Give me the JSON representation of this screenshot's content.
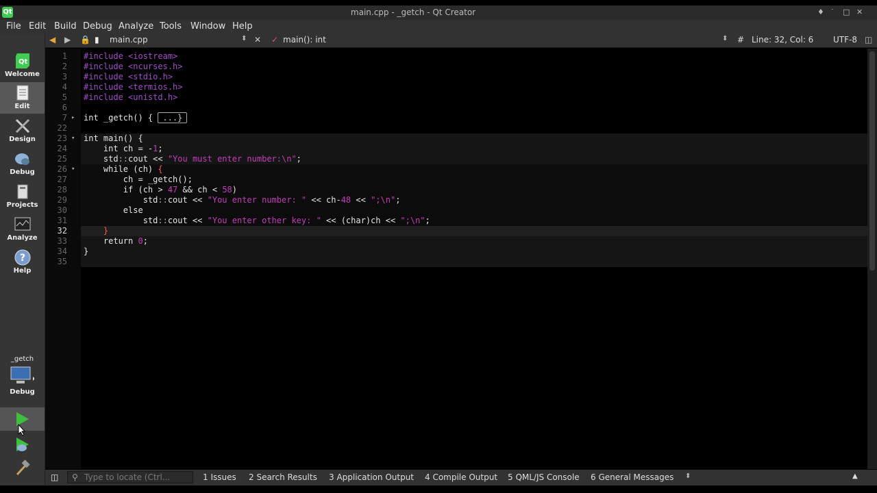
{
  "window": {
    "title": "main.cpp - _getch - Qt Creator",
    "controls": [
      "♦",
      "˙",
      "□",
      "✕"
    ]
  },
  "menu": [
    "File",
    "Edit",
    "Build",
    "Debug",
    "Analyze",
    "Tools",
    "Window",
    "Help"
  ],
  "toolbar": {
    "file_name": "main.cpp",
    "symbol": "main(): int",
    "hash": "#",
    "position": "Line: 32, Col: 6",
    "encoding": "UTF-8"
  },
  "modes": [
    {
      "label": "Welcome",
      "icon": "qt-logo-icon"
    },
    {
      "label": "Edit",
      "icon": "edit-document-icon"
    },
    {
      "label": "Design",
      "icon": "design-tools-icon"
    },
    {
      "label": "Debug",
      "icon": "debug-bug-icon"
    },
    {
      "label": "Projects",
      "icon": "projects-icon"
    },
    {
      "label": "Analyze",
      "icon": "analyze-monitor-icon"
    },
    {
      "label": "Help",
      "icon": "help-icon"
    }
  ],
  "target": {
    "project": "_getch",
    "config": "Debug"
  },
  "editor": {
    "current_line": "32",
    "lines": [
      {
        "n": "1",
        "html": "<span class='pp'>#include</span> <span class='pp'>&lt;iostream&gt;</span>"
      },
      {
        "n": "2",
        "html": "<span class='pp'>#include</span> <span class='pp'>&lt;ncurses.h&gt;</span>"
      },
      {
        "n": "3",
        "html": "<span class='pp'>#include</span> <span class='pp'>&lt;stdio.h&gt;</span>"
      },
      {
        "n": "4",
        "html": "<span class='pp'>#include</span> <span class='pp'>&lt;termios.h&gt;</span>"
      },
      {
        "n": "5",
        "html": "<span class='pp'>#include</span> <span class='pp'>&lt;unistd.h&gt;</span>"
      },
      {
        "n": "6",
        "html": ""
      },
      {
        "n": "7",
        "html": "int _getch() { <span class='fold-box'>...}</span>",
        "fold": "▸"
      },
      {
        "n": "22",
        "html": ""
      },
      {
        "n": "23",
        "html": "int main() {",
        "fold": "▾"
      },
      {
        "n": "24",
        "html": "    int ch = -<span class='num'>1</span>;"
      },
      {
        "n": "25",
        "html": "    std<span class='col'>::</span>cout &lt;&lt; <span class='str'>\"You must enter number:\\n\"</span>;"
      },
      {
        "n": "26",
        "html": "    while (ch) <span class='brace-hl'>{</span>",
        "fold": "▾"
      },
      {
        "n": "27",
        "html": "        ch = _getch();"
      },
      {
        "n": "28",
        "html": "        if (ch &gt; <span class='num'>47</span> &amp;&amp; ch &lt; <span class='num'>58</span>)"
      },
      {
        "n": "29",
        "html": "            std<span class='col'>::</span>cout &lt;&lt; <span class='str'>\"You enter number: \"</span> &lt;&lt; ch-<span class='num'>48</span> &lt;&lt; <span class='str'>\";\\n\"</span>;"
      },
      {
        "n": "30",
        "html": "        else"
      },
      {
        "n": "31",
        "html": "            std<span class='col'>::</span>cout &lt;&lt; <span class='str'>\"You enter other key: \"</span> &lt;&lt; (char)ch &lt;&lt; <span class='str'>\";\\n\"</span>;"
      },
      {
        "n": "32",
        "html": "    <span class='brace-hl'>}</span>"
      },
      {
        "n": "33",
        "html": "    return <span class='num'>0</span>;"
      },
      {
        "n": "34",
        "html": "}"
      },
      {
        "n": "35",
        "html": ""
      }
    ]
  },
  "status": {
    "locate_placeholder": "Type to locate (Ctrl...",
    "panes": [
      "1  Issues",
      "2  Search Results",
      "3  Application Output",
      "4  Compile Output",
      "5  QML/JS Console",
      "6  General Messages"
    ]
  }
}
